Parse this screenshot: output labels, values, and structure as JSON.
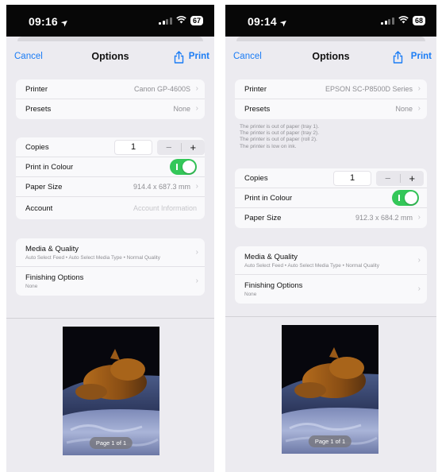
{
  "screens": [
    {
      "status": {
        "time": "09:16",
        "battery": "67"
      },
      "nav": {
        "cancel": "Cancel",
        "title": "Options",
        "print": "Print"
      },
      "printer": {
        "label": "Printer",
        "value": "Canon GP-4600S"
      },
      "presets": {
        "label": "Presets",
        "value": "None"
      },
      "copies": {
        "label": "Copies",
        "value": "1",
        "minus": "−",
        "plus": "+"
      },
      "colour": {
        "label": "Print in Colour",
        "on": true
      },
      "paper": {
        "label": "Paper Size",
        "value": "914.4 x 687.3 mm"
      },
      "account": {
        "label": "Account",
        "placeholder": "Account Information"
      },
      "media": {
        "label": "Media & Quality",
        "sub": "Auto Select Feed • Auto Select Media Type • Normal Quality"
      },
      "finishing": {
        "label": "Finishing Options",
        "sub": "None"
      },
      "page_badge": "Page 1 of 1"
    },
    {
      "status": {
        "time": "09:14",
        "battery": "68"
      },
      "nav": {
        "cancel": "Cancel",
        "title": "Options",
        "print": "Print"
      },
      "printer": {
        "label": "Printer",
        "value": "EPSON SC-P8500D Series"
      },
      "presets": {
        "label": "Presets",
        "value": "None"
      },
      "warnings": [
        "The printer is out of paper (tray 1).",
        "The printer is out of paper (tray 2).",
        "The printer is out of paper (roll 2).",
        "The printer is low on ink."
      ],
      "copies": {
        "label": "Copies",
        "value": "1",
        "minus": "−",
        "plus": "+"
      },
      "colour": {
        "label": "Print in Colour",
        "on": true
      },
      "paper": {
        "label": "Paper Size",
        "value": "912.3 x 684.2 mm"
      },
      "media": {
        "label": "Media & Quality",
        "sub": "Auto Select Feed • Auto Select Media Type • Normal Quality"
      },
      "finishing": {
        "label": "Finishing Options",
        "sub": "None"
      },
      "page_badge": "Page 1 of 1"
    }
  ],
  "colors": {
    "accent": "#1a7cf5",
    "toggle_on": "#34c759",
    "sheet_bg": "#ecebf0",
    "cell_bg": "#f9f9fb"
  }
}
